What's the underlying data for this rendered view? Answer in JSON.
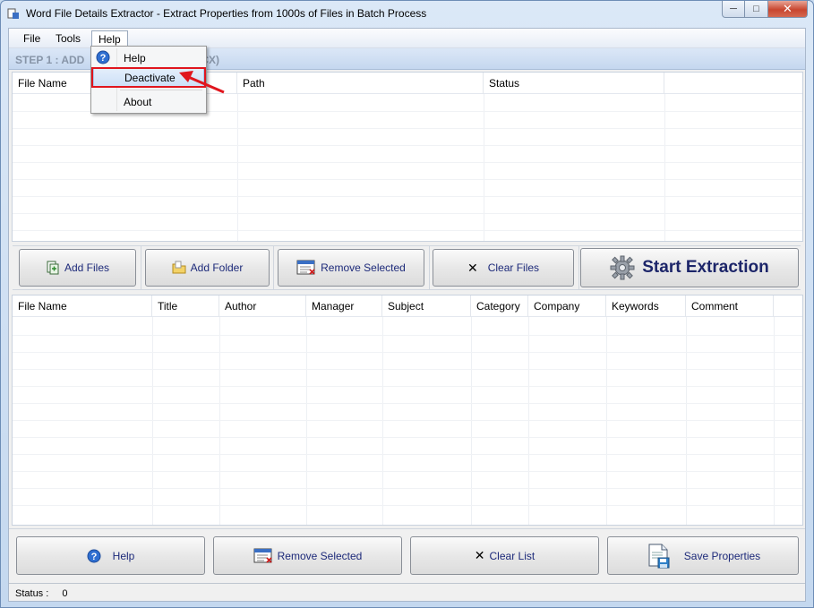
{
  "window": {
    "title": "Word File Details Extractor - Extract Properties from 1000s of Files in Batch Process"
  },
  "menu": {
    "file": "File",
    "tools": "Tools",
    "help": "Help"
  },
  "help_menu": {
    "items": [
      "Help",
      "Deactivate",
      "About"
    ]
  },
  "step": {
    "prefix": "STEP 1 : ADD",
    "suffix": "OCX)"
  },
  "files_table": {
    "columns": [
      "File Name",
      "Path",
      "Status"
    ]
  },
  "actions": {
    "add_files": "Add Files",
    "add_folder": "Add Folder",
    "remove_selected": "Remove Selected",
    "clear_files": "Clear Files",
    "start_extraction": "Start Extraction"
  },
  "props_table": {
    "columns": [
      "File Name",
      "Title",
      "Author",
      "Manager",
      "Subject",
      "Category",
      "Company",
      "Keywords",
      "Comment"
    ]
  },
  "bottom": {
    "help": "Help",
    "remove_selected": "Remove Selected",
    "clear_list": "Clear List",
    "save_properties": "Save Properties"
  },
  "status": {
    "label": "Status :",
    "value": "0"
  },
  "colors": {
    "highlight_border": "#e0161e",
    "accent_text": "#1d2a7a"
  }
}
